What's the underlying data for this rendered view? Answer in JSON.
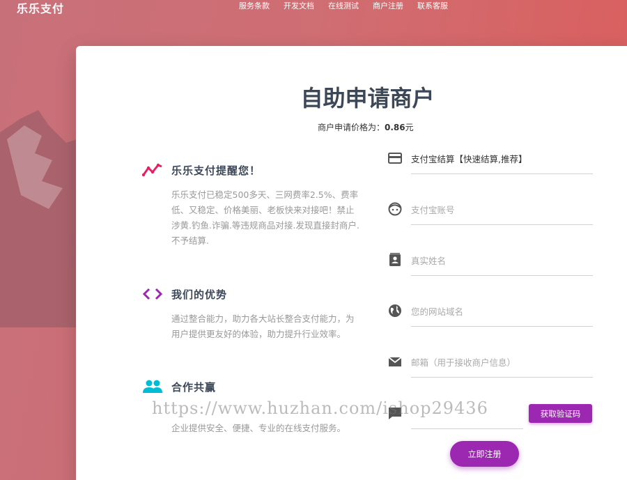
{
  "brand": "乐乐支付",
  "nav": [
    "服务条款",
    "开发文档",
    "在线测试",
    "商户注册",
    "联系客服"
  ],
  "title": "自助申请商户",
  "price": {
    "label": "商户申请价格为：",
    "value": "0.86",
    "unit": "元"
  },
  "info": [
    {
      "icon": "trending-icon",
      "heading": "乐乐支付提醒您！",
      "text": "乐乐支付已稳定500多天、三网费率2.5%、费率低、又稳定、价格美丽、老板快来对接吧！禁止涉黄.钓鱼.诈骗.等违规商品对接.发现直接封商户.不予结算."
    },
    {
      "icon": "code-icon",
      "heading": "我们的优势",
      "text": "通过整合能力，助力各大站长整合支付能力，为用户提供更友好的体验，助力提升行业效率。"
    },
    {
      "icon": "people-icon",
      "heading": "合作共赢",
      "text": "企业提供安全、便捷、专业的在线支付服务。"
    }
  ],
  "form": {
    "settlement": "支付宝结算【快速结算,推荐】",
    "alipay_placeholder": "支付宝账号",
    "name_placeholder": "真实姓名",
    "domain_placeholder": "您的网站域名",
    "email_placeholder": "邮箱（用于接收商户信息）",
    "code_placeholder": "",
    "get_code": "获取验证码",
    "submit": "立即注册"
  },
  "watermark": "https://www.huzhan.com/ishop29436",
  "colors": {
    "accent": "#9c27b0",
    "icon_pink": "#e91e63",
    "icon_purple": "#9c27b0",
    "icon_cyan": "#00bcd4"
  }
}
